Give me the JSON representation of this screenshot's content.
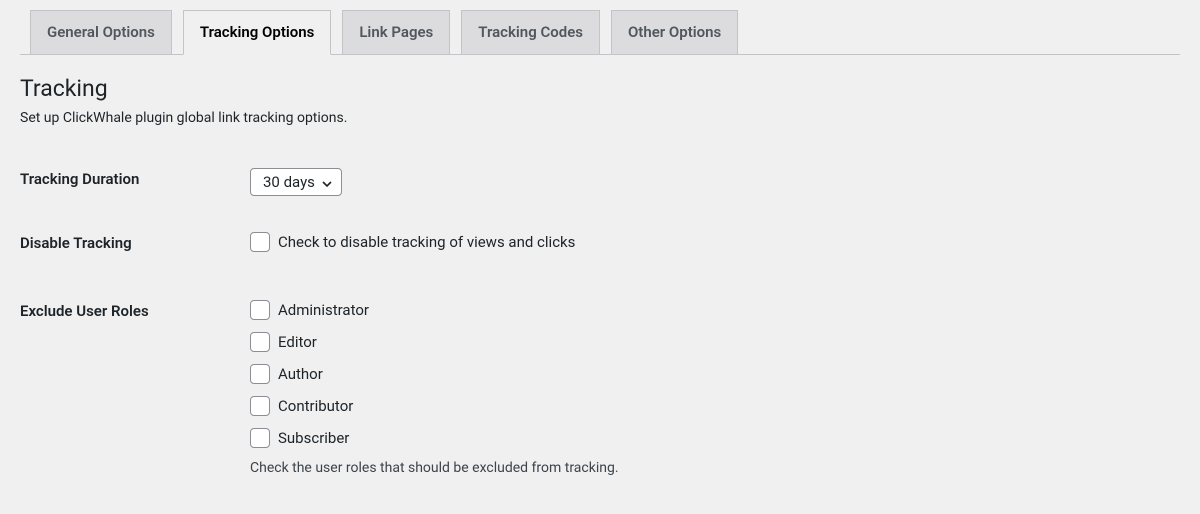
{
  "tabs": [
    {
      "label": "General Options",
      "active": false
    },
    {
      "label": "Tracking Options",
      "active": true
    },
    {
      "label": "Link Pages",
      "active": false
    },
    {
      "label": "Tracking Codes",
      "active": false
    },
    {
      "label": "Other Options",
      "active": false
    }
  ],
  "section": {
    "title": "Tracking",
    "description": "Set up ClickWhale plugin global link tracking options."
  },
  "fields": {
    "tracking_duration": {
      "label": "Tracking Duration",
      "value": "30 days"
    },
    "disable_tracking": {
      "label": "Disable Tracking",
      "checkbox_label": "Check to disable tracking of views and clicks"
    },
    "exclude_user_roles": {
      "label": "Exclude User Roles",
      "options": [
        "Administrator",
        "Editor",
        "Author",
        "Contributor",
        "Subscriber"
      ],
      "description": "Check the user roles that should be excluded from tracking."
    }
  }
}
